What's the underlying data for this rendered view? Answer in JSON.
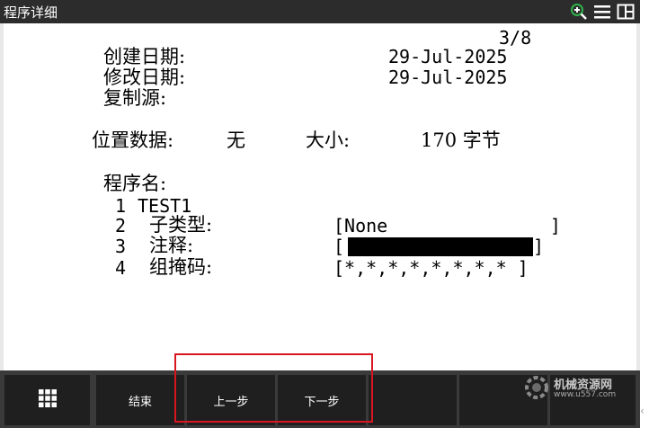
{
  "window": {
    "title": "程序详细"
  },
  "page": "3/8",
  "fields": {
    "created_label": "创建日期:",
    "created_value": "29-Jul-2025",
    "modified_label": "修改日期:",
    "modified_value": "29-Jul-2025",
    "copy_source_label": "复制源:",
    "position_label": "位置数据:",
    "position_value": "无",
    "size_label": "大小:",
    "size_value": "170 字节"
  },
  "program": {
    "name_label": "程序名:",
    "rows": [
      {
        "num": "1",
        "label": "TEST1",
        "value": ""
      },
      {
        "num": "2",
        "label": "子类型:",
        "value": "[None               ]"
      },
      {
        "num": "3",
        "label": "注释:",
        "value_open": "[",
        "value_close": "]"
      },
      {
        "num": "4",
        "label": "组掩码:",
        "value": "[*,*,*,*,*,*,*,* ]"
      }
    ]
  },
  "softkeys": [
    {
      "label": ""
    },
    {
      "label": "结束"
    },
    {
      "label": "上一步"
    },
    {
      "label": "下一步"
    },
    {
      "label": ""
    },
    {
      "label": ""
    },
    {
      "label": ""
    }
  ],
  "watermark": {
    "text": "机械资源网",
    "url": "www.u557.com"
  },
  "icons": {
    "zoom": "zoom-in-icon",
    "menu": "menu-lines-icon",
    "layout": "split-view-icon",
    "grid": "grid-menu-icon",
    "side": "chevron-left-icon"
  },
  "colors": {
    "titlebar": "#2c2c2c",
    "softkey": "#1f1f1f",
    "highlight": "#d8161f",
    "zoom_accent": "#2fb34a"
  }
}
